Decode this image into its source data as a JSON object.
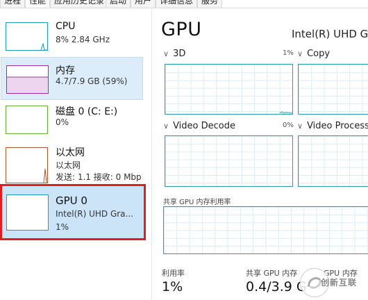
{
  "tabs": [
    {
      "label": "进程"
    },
    {
      "label": "性能"
    },
    {
      "label": "应用历史记录"
    },
    {
      "label": "启动"
    },
    {
      "label": "用户"
    },
    {
      "label": "详细信息"
    },
    {
      "label": "服务"
    }
  ],
  "sidebar": {
    "items": [
      {
        "title": "CPU",
        "sub1": "8% 2.84 GHz",
        "color": "#1a9bc9"
      },
      {
        "title": "内存",
        "sub1": "4.7/7.9 GB (59%)",
        "color": "#9c2fa6"
      },
      {
        "title": "磁盘 0 (C: E:)",
        "sub1": "0%",
        "color": "#62b02e"
      },
      {
        "title": "以太网",
        "sub1": "以太网",
        "sub2": "发送: 1.1 接收: 0 Mbp",
        "color": "#a8582a"
      },
      {
        "title": "GPU 0",
        "sub1": "Intel(R) UHD Gra...",
        "sub2": "1%",
        "color": "#1a9bc9"
      }
    ]
  },
  "main": {
    "title": "GPU",
    "model": "Intel(R) UHD G",
    "engines": [
      {
        "label": "3D",
        "pct": "1%"
      },
      {
        "label": "Copy",
        "pct": ""
      },
      {
        "label": "Video Decode",
        "pct": "0%"
      },
      {
        "label": "Video Processi",
        "pct": ""
      }
    ],
    "shared_memory_caption": "共享 GPU 内存利用率",
    "stats": [
      {
        "label": "利用率",
        "value": "1%"
      },
      {
        "label": "共享 GPU 内存",
        "value": "0.4/3.9 G"
      },
      {
        "label": "GPU 内存",
        "value": ""
      }
    ]
  },
  "watermark": {
    "text": "创新互联"
  }
}
